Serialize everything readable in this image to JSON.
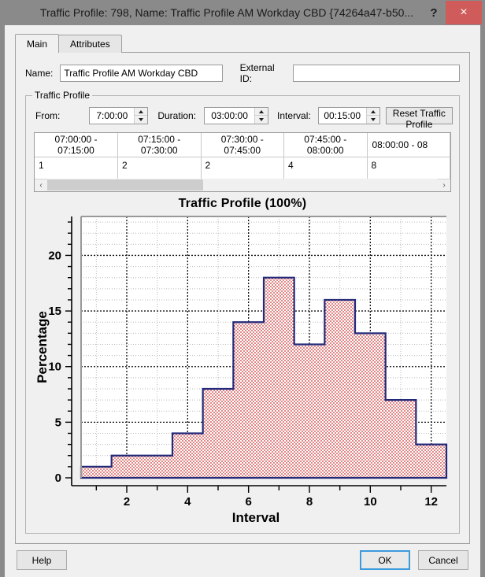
{
  "window": {
    "title": "Traffic Profile: 798, Name: Traffic Profile AM Workday CBD  {74264a47-b50...",
    "help_glyph": "?",
    "close_glyph": "×"
  },
  "tabs": [
    {
      "label": "Main",
      "active": true
    },
    {
      "label": "Attributes",
      "active": false
    }
  ],
  "form": {
    "name_label": "Name:",
    "name_value": "Traffic Profile AM Workday CBD",
    "external_id_label": "External ID:",
    "external_id_value": "",
    "external_id_placeholder": ""
  },
  "group": {
    "title": "Traffic Profile",
    "from_label": "From:",
    "from_value": "7:00:00",
    "duration_label": "Duration:",
    "duration_value": "03:00:00",
    "interval_label": "Interval:",
    "interval_value": "00:15:00",
    "reset_button": "Reset Traffic Profile"
  },
  "table": {
    "headers": [
      "07:00:00 - 07:15:00",
      "07:15:00 - 07:30:00",
      "07:30:00 - 07:45:00",
      "07:45:00 - 08:00:00",
      "08:00:00 - 08"
    ],
    "row": [
      "1",
      "2",
      "2",
      "4",
      "8"
    ],
    "scroll_left_glyph": "‹",
    "scroll_right_glyph": "›"
  },
  "chart_data": {
    "type": "bar",
    "title": "Traffic Profile (100%)",
    "xlabel": "Interval",
    "ylabel": "Percentage",
    "categories": [
      1,
      2,
      3,
      4,
      5,
      6,
      7,
      8,
      9,
      10,
      11,
      12
    ],
    "values": [
      1,
      2,
      2,
      4,
      8,
      14,
      18,
      12,
      16,
      13,
      7,
      3
    ],
    "xlim": [
      0.5,
      12.5
    ],
    "ylim": [
      0,
      23.5
    ],
    "xticks": [
      2,
      4,
      6,
      8,
      10,
      12
    ],
    "xminorticks": [
      1,
      3,
      5,
      7,
      9,
      11
    ],
    "yticks": [
      0,
      5,
      10,
      15,
      20
    ],
    "yminorticks": [
      1,
      2,
      3,
      4,
      6,
      7,
      8,
      9,
      11,
      12,
      13,
      14,
      16,
      17,
      18,
      19,
      21,
      22,
      23
    ],
    "grid": true,
    "line_color": "#232a7a",
    "fill_color": "#cc2222",
    "legend": "none"
  },
  "footer": {
    "help_label": "Help",
    "ok_label": "OK",
    "cancel_label": "Cancel"
  }
}
